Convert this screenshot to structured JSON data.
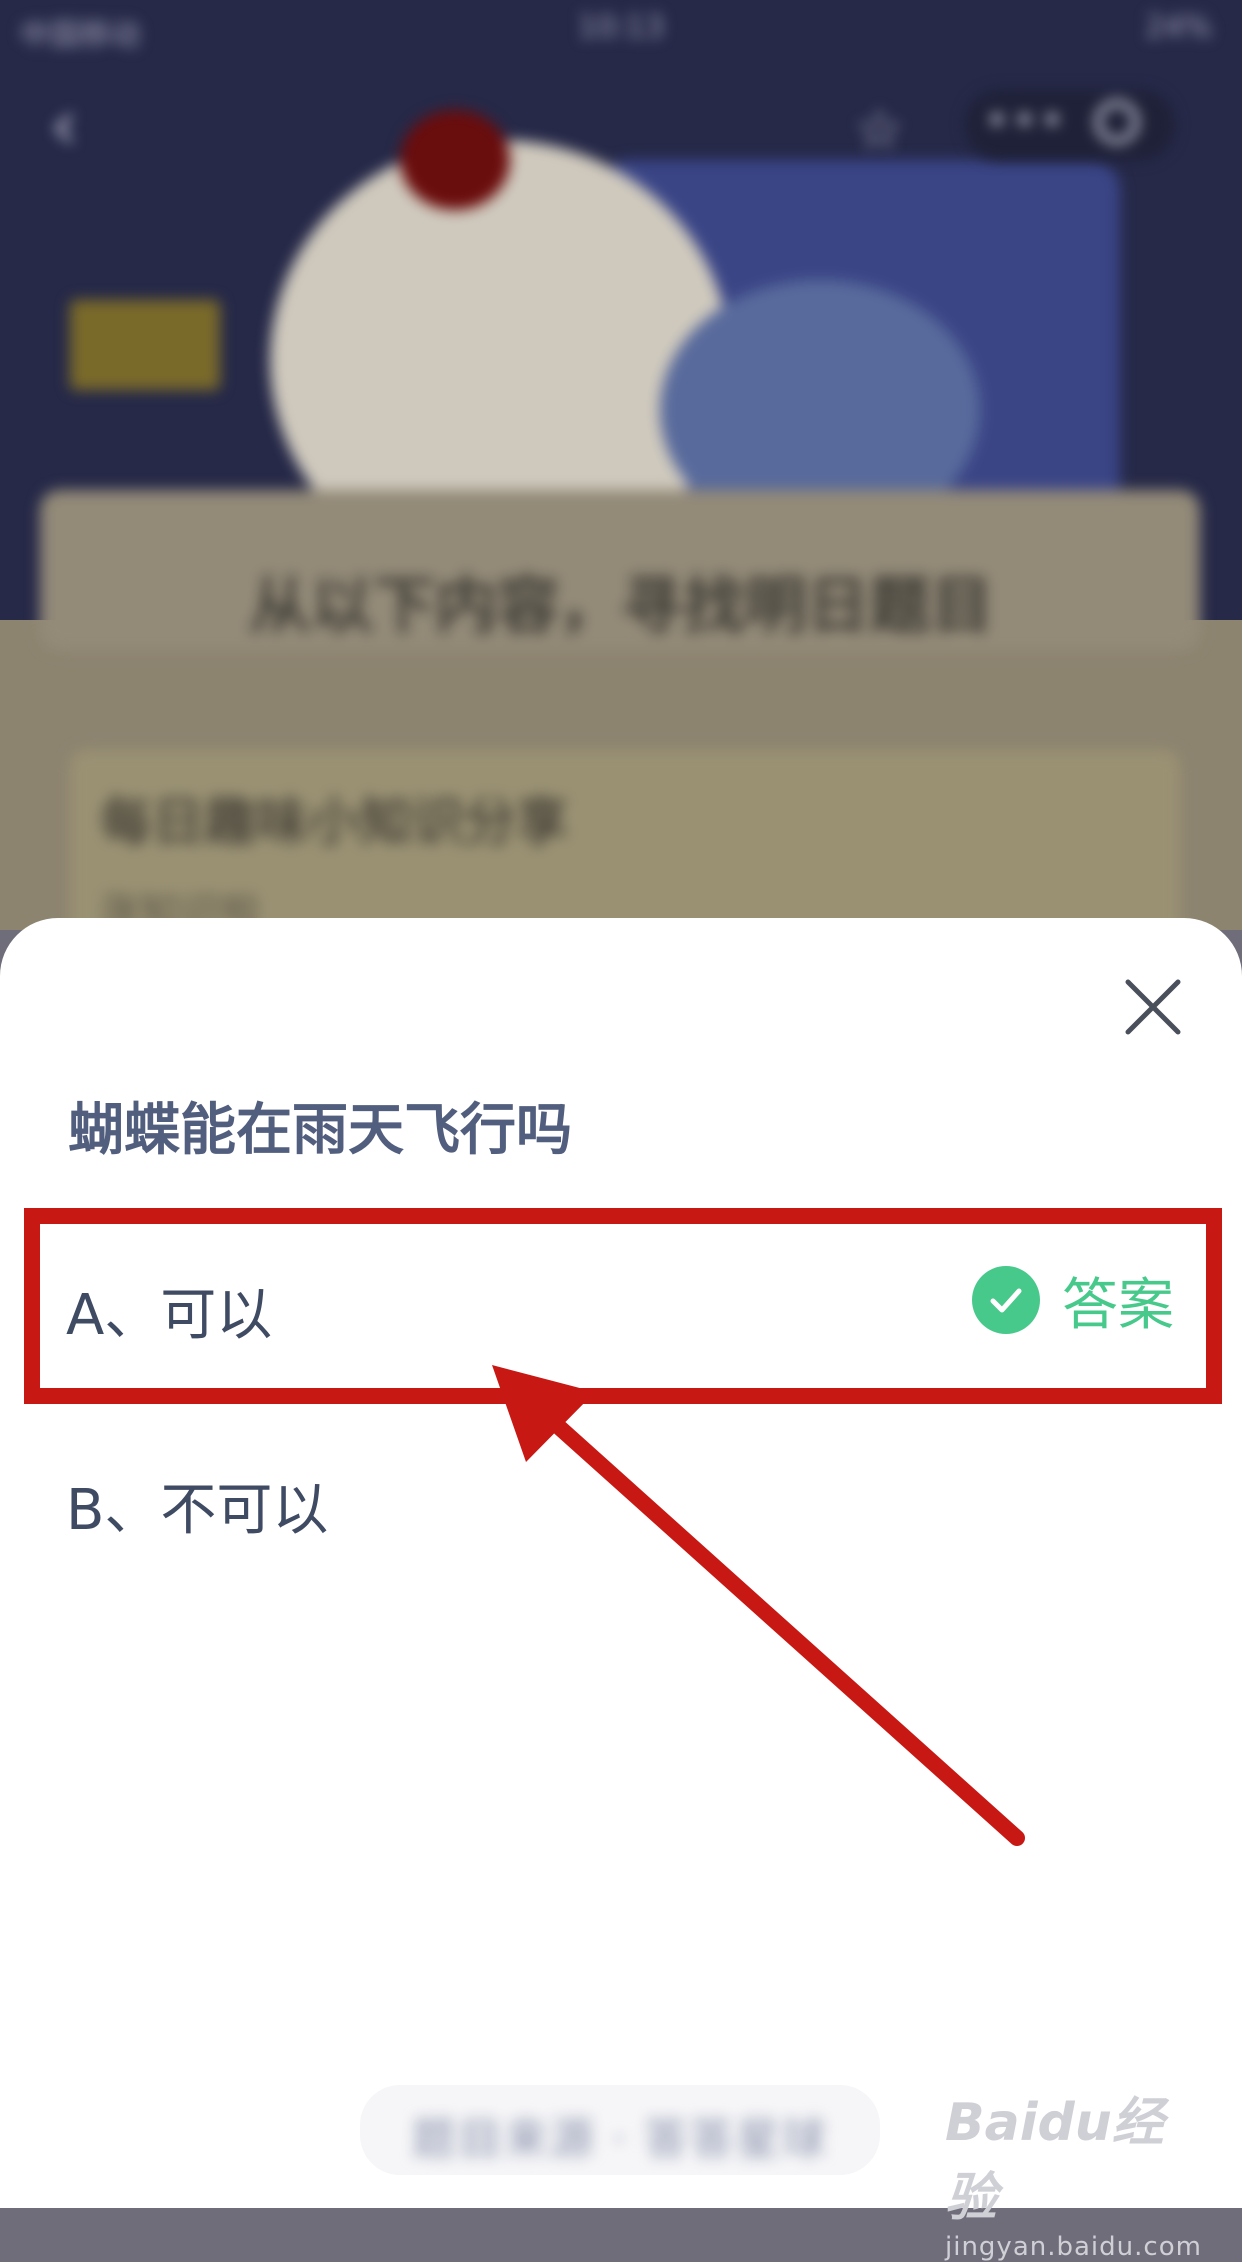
{
  "status_bar": {
    "carrier": "中国移动",
    "time": "10:13",
    "battery": "24%"
  },
  "background": {
    "headline": "从以下内容，寻找明日题目",
    "card_title": "每日趣味小知识分享",
    "card_subtitle": "涨知识啦"
  },
  "quiz": {
    "question": "蝴蝶能在雨天飞行吗",
    "options": [
      {
        "label": "A、可以",
        "is_answer": true
      },
      {
        "label": "B、不可以",
        "is_answer": false
      }
    ],
    "answer_label": "答案",
    "footer_button": "题目来源 · 答答星球"
  },
  "watermark": {
    "brand": "Baidu经验",
    "url": "jingyan.baidu.com"
  },
  "colors": {
    "accent_green": "#47c98b",
    "annotation_red": "#c81814",
    "question_text": "#525e7e"
  }
}
